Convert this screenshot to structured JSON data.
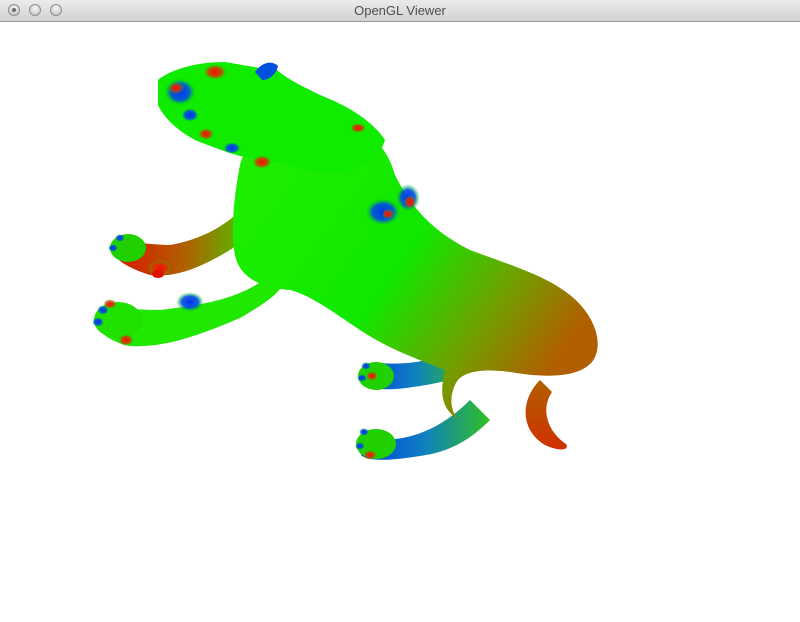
{
  "window": {
    "title": "OpenGL Viewer",
    "buttons": {
      "close": "close-button",
      "minimize": "minimize-button",
      "zoom": "zoom-button"
    }
  },
  "viewport": {
    "background": "#ffffff",
    "model": "cat-mesh",
    "colors": {
      "green": "#00ee00",
      "blue": "#0044ee",
      "red": "#ee1100",
      "olive": "#a06a00"
    }
  }
}
